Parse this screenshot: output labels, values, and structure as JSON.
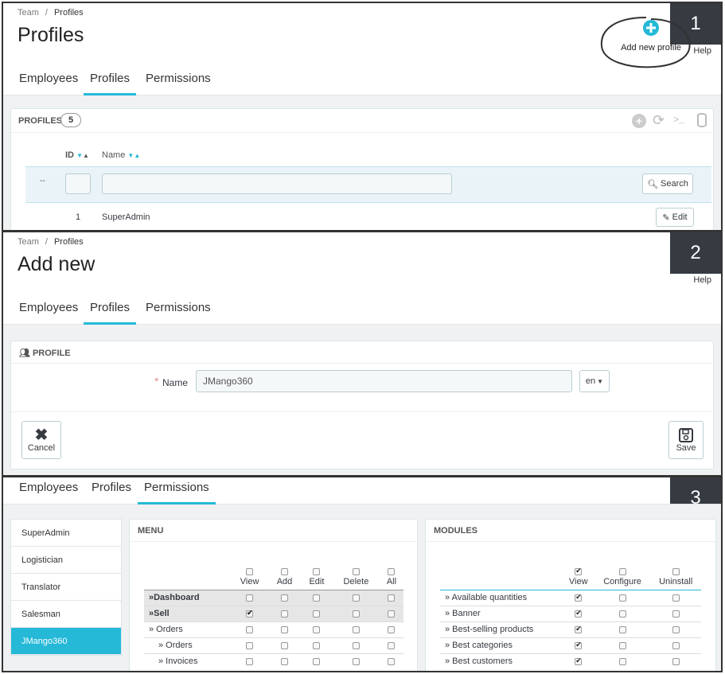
{
  "step1": {
    "number": "1",
    "breadcrumb": {
      "parent": "Team",
      "sep": "/",
      "current": "Profiles"
    },
    "title": "Profiles",
    "add_label": "Add new profile",
    "help": "Help",
    "tabs": [
      "Employees",
      "Profiles",
      "Permissions"
    ],
    "list": {
      "heading": "PROFILES",
      "count": "5",
      "col_id": "ID",
      "col_name": "Name",
      "filter_dash": "--",
      "search_label": "Search",
      "row_id": "1",
      "row_name": "SuperAdmin",
      "edit_label": "Edit"
    }
  },
  "step2": {
    "number": "2",
    "breadcrumb": {
      "parent": "Team",
      "sep": "/",
      "current": "Profiles"
    },
    "title": "Add new",
    "help": "Help",
    "tabs": [
      "Employees",
      "Profiles",
      "Permissions"
    ],
    "form": {
      "heading": "PROFILE",
      "required": "*",
      "name_label": "Name",
      "name_value": "JMango360",
      "lang": "en",
      "cancel_label": "Cancel",
      "save_label": "Save"
    }
  },
  "step3": {
    "number": "3",
    "tabs": [
      "Employees",
      "Profiles",
      "Permissions"
    ],
    "profiles": [
      "SuperAdmin",
      "Logistician",
      "Translator",
      "Salesman",
      "JMango360"
    ],
    "selected_profile": "JMango360",
    "menu": {
      "heading": "MENU",
      "columns": [
        "View",
        "Add",
        "Edit",
        "Delete",
        "All"
      ],
      "rows": [
        {
          "label": "»Dashboard",
          "bold": true,
          "checks": [
            false,
            false,
            false,
            false,
            false
          ]
        },
        {
          "label": "»Sell",
          "bold": true,
          "checks": [
            true,
            false,
            false,
            false,
            false
          ]
        },
        {
          "label": "» Orders",
          "bold": false,
          "checks": [
            false,
            false,
            false,
            false,
            false
          ]
        },
        {
          "label": "» Orders",
          "bold": false,
          "checks": [
            false,
            false,
            false,
            false,
            false
          ]
        },
        {
          "label": "» Invoices",
          "bold": false,
          "checks": [
            false,
            false,
            false,
            false,
            false
          ]
        }
      ]
    },
    "modules": {
      "heading": "MODULES",
      "columns": [
        "View",
        "Configure",
        "Uninstall"
      ],
      "header_checks": [
        true,
        false,
        false
      ],
      "rows": [
        {
          "label": "» Available quantities",
          "checks": [
            true,
            false,
            false
          ]
        },
        {
          "label": "» Banner",
          "checks": [
            true,
            false,
            false
          ]
        },
        {
          "label": "» Best-selling products",
          "checks": [
            true,
            false,
            false
          ]
        },
        {
          "label": "» Best categories",
          "checks": [
            true,
            false,
            false
          ]
        },
        {
          "label": "» Best customers",
          "checks": [
            true,
            false,
            false
          ]
        }
      ]
    }
  },
  "colors": {
    "accent": "#25b9d7",
    "dark": "#363a41",
    "required": "#e08f95"
  }
}
